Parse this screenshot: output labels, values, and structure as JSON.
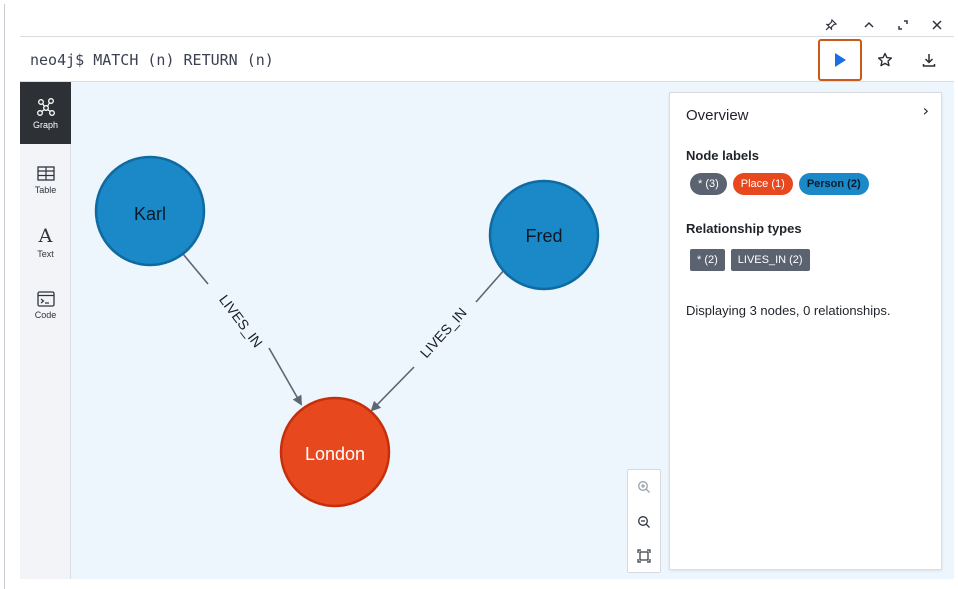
{
  "window_controls": {
    "pin": "⚲",
    "collapse": "⌃",
    "expand": "⤢",
    "close": "✕"
  },
  "editor": {
    "query": "neo4j$ MATCH (n) RETURN (n)"
  },
  "sidebar": {
    "items": [
      {
        "label": "Graph",
        "icon": "graph-icon",
        "active": true
      },
      {
        "label": "Table",
        "icon": "table-icon",
        "active": false
      },
      {
        "label": "Text",
        "icon": "text-icon",
        "active": false
      },
      {
        "label": "Code",
        "icon": "code-icon",
        "active": false
      }
    ]
  },
  "graph": {
    "nodes": [
      {
        "label": "Karl",
        "type": "Person",
        "color": "#1b88c7"
      },
      {
        "label": "Fred",
        "type": "Person",
        "color": "#1b88c7"
      },
      {
        "label": "London",
        "type": "Place",
        "color": "#e8481e"
      }
    ],
    "relationships": [
      {
        "from": "Karl",
        "to": "London",
        "type": "LIVES_IN"
      },
      {
        "from": "Fred",
        "to": "London",
        "type": "LIVES_IN"
      }
    ]
  },
  "overview": {
    "title": "Overview",
    "node_labels_heading": "Node labels",
    "node_labels": [
      {
        "text": "* (3)",
        "kind": "grey"
      },
      {
        "text": "Place (1)",
        "kind": "place"
      },
      {
        "text": "Person (2)",
        "kind": "person"
      }
    ],
    "rel_types_heading": "Relationship types",
    "rel_types": [
      "* (2)",
      "LIVES_IN (2)"
    ],
    "summary": "Displaying 3 nodes, 0 relationships."
  },
  "colors": {
    "person": "#1b88c7",
    "place": "#e8481e",
    "run_highlight": "#c95a19",
    "run_icon": "#1a6fe8"
  }
}
